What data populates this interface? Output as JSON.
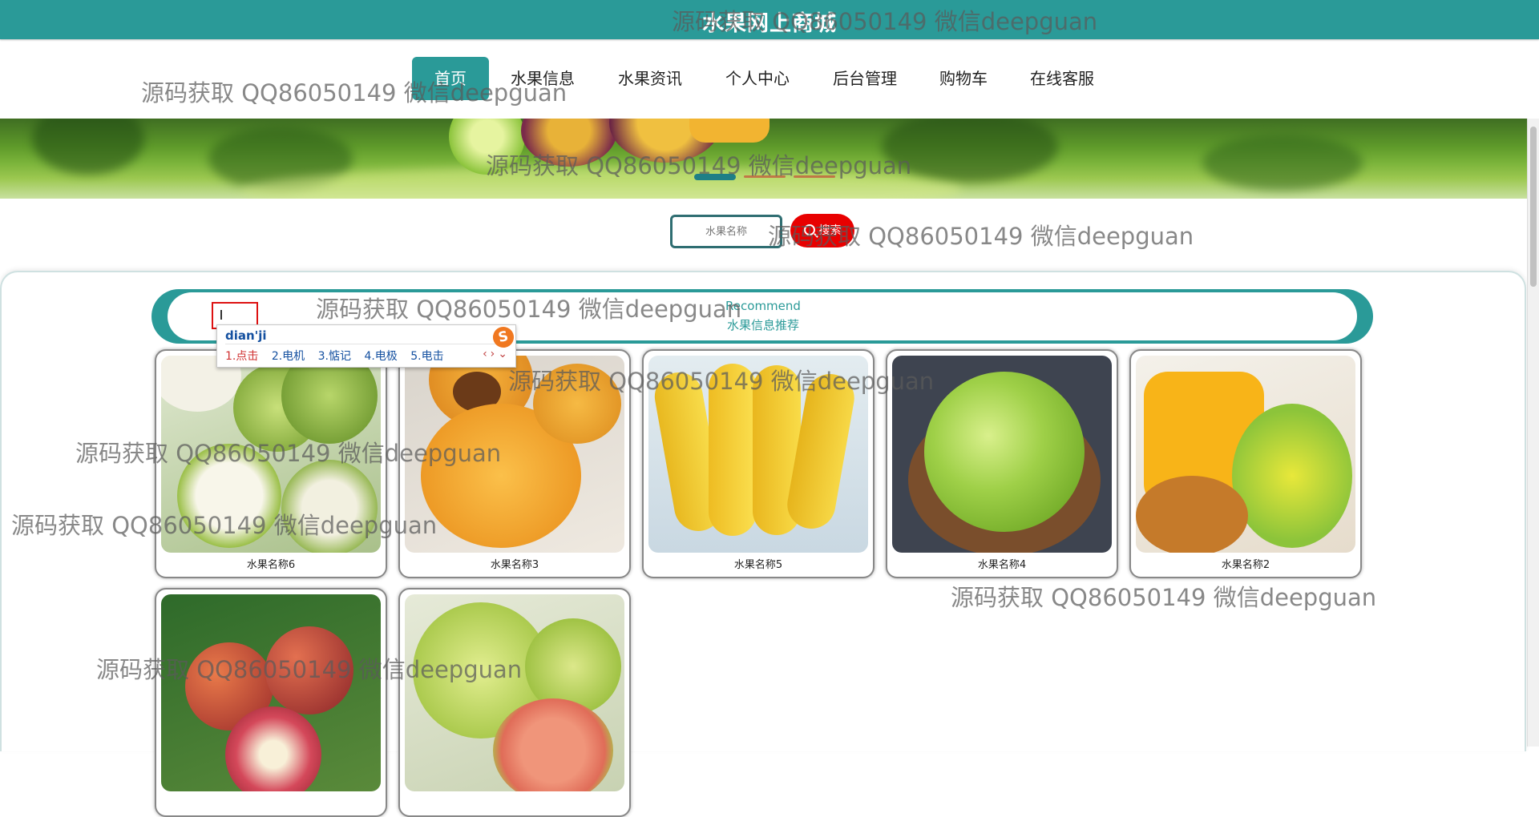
{
  "header": {
    "title": "水果网上商城"
  },
  "nav": {
    "items": [
      {
        "label": "首页",
        "active": true
      },
      {
        "label": "水果信息"
      },
      {
        "label": "水果资讯"
      },
      {
        "label": "个人中心"
      },
      {
        "label": "后台管理"
      },
      {
        "label": "购物车"
      },
      {
        "label": "在线客服"
      }
    ]
  },
  "banner": {
    "active_slide": 1,
    "slide_count": 3
  },
  "search": {
    "placeholder": "水果名称",
    "button_label": "搜索",
    "icon": "search-icon"
  },
  "recommend": {
    "title_en": "Recommend",
    "title_cn": "水果信息推荐"
  },
  "products": [
    {
      "name": "水果名称6",
      "image": "jujube-apples"
    },
    {
      "name": "水果名称3",
      "image": "loquats"
    },
    {
      "name": "水果名称5",
      "image": "bananas"
    },
    {
      "name": "水果名称4",
      "image": "green-grapes"
    },
    {
      "name": "水果名称2",
      "image": "mangoes"
    },
    {
      "name": "",
      "image": "plums"
    },
    {
      "name": "",
      "image": "guavas"
    }
  ],
  "ime": {
    "pinyin": "dian'ji",
    "candidates": [
      "1.点击",
      "2.电机",
      "3.惦记",
      "4.电极",
      "5.电击"
    ],
    "logo": "S"
  },
  "watermark": {
    "text": "源码获取 QQ86050149 微信deepguan"
  },
  "colors": {
    "primary": "#2a9a98",
    "search_button": "#e80000",
    "title_text": "#ffffff"
  }
}
